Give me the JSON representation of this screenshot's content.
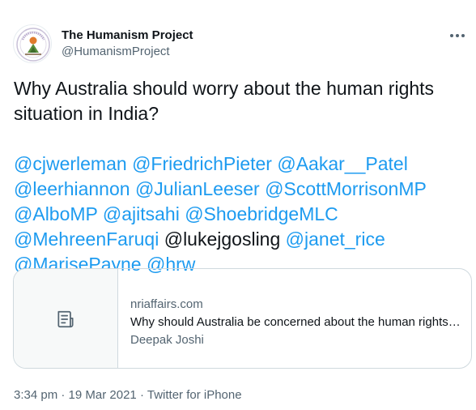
{
  "author": {
    "name": "The Humanism Project",
    "handle": "@HumanismProject",
    "avatar_icon": "humanism-project-logo"
  },
  "tweet": {
    "line1": "Why Australia should worry about the human rights",
    "line2": "situation in India?",
    "mentions": {
      "cjwerleman": "@cjwerleman",
      "FriedrichPieter": "@FriedrichPieter",
      "Aakar__Patel": "@Aakar__Patel",
      "leerhiannon": "@leerhiannon",
      "JulianLeeser": "@JulianLeeser",
      "ScottMorrisonMP": "@ScottMorrisonMP",
      "AlboMP": "@AlboMP",
      "ajitsahi": "@ajitsahi",
      "ShoebridgeMLC": "@ShoebridgeMLC",
      "MehreenFaruqi": "@MehreenFaruqi",
      "lukejgosling": "@lukejgosling",
      "janet_rice": "@janet_rice",
      "MarisePayne": "@MarisePayne",
      "hrw": "@hrw"
    }
  },
  "card": {
    "domain": "nriaffairs.com",
    "title": "Why should Australia be concerned about the human rights …",
    "description": "Deepak Joshi",
    "thumb_icon": "article-icon"
  },
  "meta": {
    "time": "3:34 pm",
    "separator": "·",
    "date": "19 Mar 2021",
    "source": "Twitter for iPhone"
  },
  "colors": {
    "accent": "#1d9bf0",
    "text": "#0f1419",
    "secondary": "#536471",
    "border": "#cfd9de"
  }
}
